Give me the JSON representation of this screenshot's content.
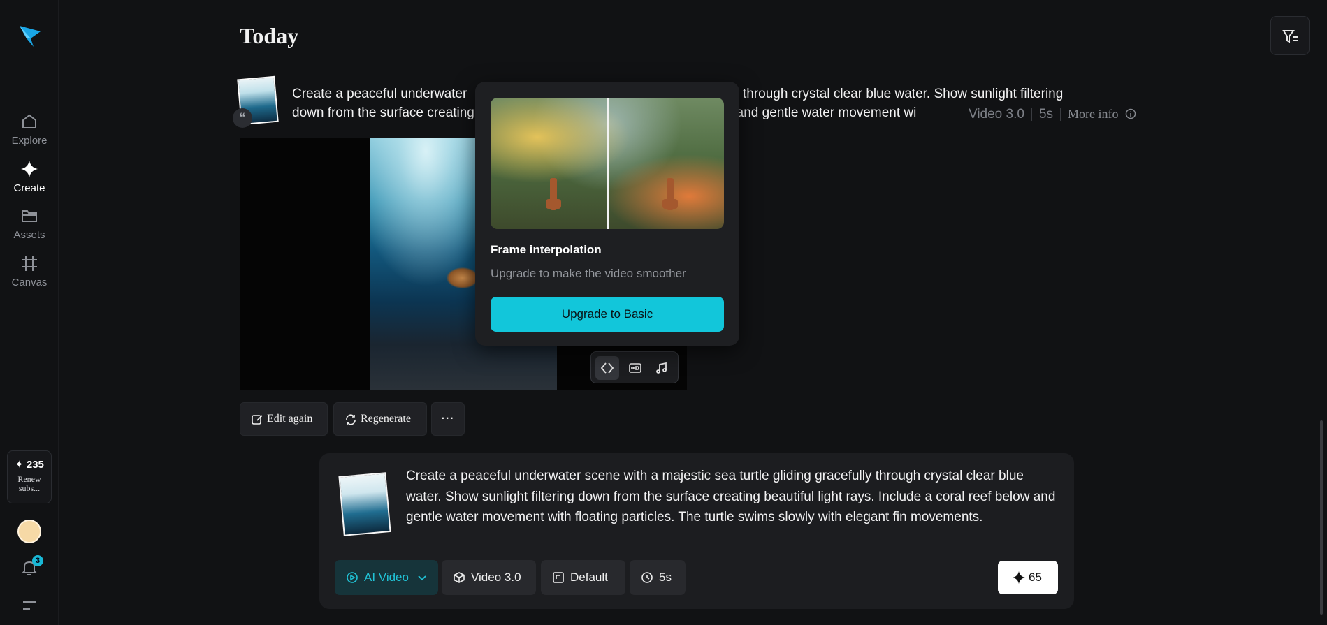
{
  "sidebar": {
    "items": [
      {
        "label": "Explore",
        "icon": "home-icon"
      },
      {
        "label": "Create",
        "icon": "sparkle-icon"
      },
      {
        "label": "Assets",
        "icon": "folder-icon"
      },
      {
        "label": "Canvas",
        "icon": "grid-icon"
      }
    ],
    "credits": "✦ 235",
    "renew": "Renew subs...",
    "notifications_count": "3"
  },
  "header": {
    "title": "Today"
  },
  "generation": {
    "prompt_line1_left": "Create a peaceful underwater",
    "prompt_line1_right": "efully through crystal clear blue water. Show sunlight filtering",
    "prompt_line2_left": "down from the surface creating",
    "prompt_line2_right": "low and gentle water movement wi",
    "model": "Video 3.0",
    "duration": "5s",
    "more_info": "More info",
    "quote_icon": "quote-icon"
  },
  "actions": {
    "edit_again": "Edit again",
    "regenerate": "Regenerate",
    "more": "···"
  },
  "popup": {
    "title": "Frame interpolation",
    "subtitle": "Upgrade to make the video smoother",
    "button": "Upgrade to Basic"
  },
  "composer": {
    "prompt": "Create a peaceful underwater scene with a majestic sea turtle gliding gracefully through crystal clear blue water. Show sunlight filtering down from the surface creating beautiful light rays. Include a coral reef below and gentle water movement with floating particles. The turtle swims slowly with elegant fin movements.",
    "mode": "AI Video",
    "model": "Video 3.0",
    "ratio": "Default",
    "duration": "5s",
    "cost": "65"
  },
  "colors": {
    "accent": "#12c6da",
    "background": "#111214"
  }
}
